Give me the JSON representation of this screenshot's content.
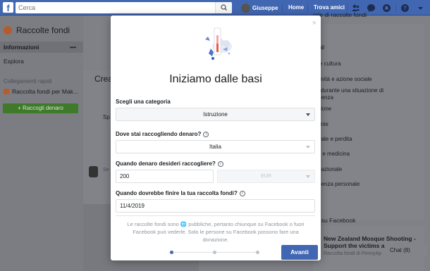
{
  "topbar": {
    "search_placeholder": "Cerca",
    "user_name": "Giuseppe",
    "home": "Home",
    "find_friends": "Trova amici"
  },
  "left": {
    "title": "Raccolte fondi",
    "info": "Informazioni",
    "dots": "•••",
    "explore": "Esplora",
    "quick_links": "Collegamenti rapidi",
    "link_item": "Raccolta fondi per Mak...",
    "raise_button": "+ Raccogli denaro"
  },
  "center": {
    "create": "Crea",
    "sp": "Sp",
    "se": "Se"
  },
  "right": {
    "heading": "orie di raccolte fondi",
    "items": [
      "imali",
      "te e cultura",
      "munità e azione sociale",
      "uti durante una situazione di",
      "ergenza",
      "ruzione",
      "biente",
      "nerale e perdita",
      "ute e medicina",
      "ernazionale",
      "ergenza personale",
      "e",
      "ort"
    ],
    "card2_heading": "ari su Facebook",
    "card2_title": "New Zealand Mosque Shooting - Support the victims a",
    "card2_sub": "Raccolta fondi di PennyAp",
    "chat": "Chat (8)"
  },
  "modal": {
    "close": "×",
    "title": "Iniziamo dalle basi",
    "category_label": "Scegli una categoria",
    "category_value": "Istruzione",
    "where_label": "Dove stai raccogliendo denaro?",
    "where_value": "Italia",
    "amount_label": "Quando denaro desideri raccogliere?",
    "amount_value": "200",
    "currency_value": "EUR",
    "end_label": "Quando dovrebbe finire la tua raccolta fondi?",
    "end_value": "11/4/2019",
    "note": "Le raccolte fondi sono 🌐 pubbliche, pertanto chiunque su Facebook o fuori Facebook può vederle. Solo le persone su Facebook possono fare una donazione.",
    "next_button": "Avanti",
    "steps_total": 3,
    "step_current": 1
  },
  "colors": {
    "facebook_blue": "#4267b2",
    "green_button": "#42b72a"
  }
}
